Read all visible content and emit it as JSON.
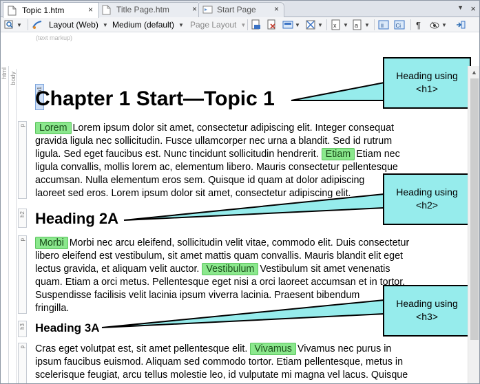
{
  "tabs": [
    {
      "label": "Topic 1.htm",
      "close": "×"
    },
    {
      "label": "Title Page.htm",
      "close": "×"
    },
    {
      "label": "Start Page",
      "close": "×"
    }
  ],
  "tabstrip_close": "×",
  "tabstrip_scroll": "▼",
  "toolbar": {
    "layout": "Layout (Web)",
    "medium": "Medium (default)",
    "page_layout": "Page Layout",
    "subtool_label": "(text markup)"
  },
  "structure": {
    "html": "html",
    "body": "body",
    "h1": "h1",
    "p": "p",
    "h2": "h2",
    "h3": "h3"
  },
  "doc": {
    "h1": "Chapter 1 Start—Topic 1",
    "h2": "Heading 2A",
    "h3": "Heading 3A",
    "para1": {
      "mark1": "Lorem",
      "line1": "Lorem ipsum dolor sit amet, consectetur adipiscing elit. Integer consequat",
      "line2": "gravida ligula nec sollicitudin. Fusce ullamcorper nec urna a blandit. Sed id rutrum",
      "line3a": "ligula. Sed eget faucibus est. Nunc tincidunt sollicitudin hendrerit.",
      "mark2": "Etiam",
      "line3b": "Etiam nec",
      "line4": "ligula convallis, mollis lorem ac, elementum libero. Mauris consectetur pellentesque",
      "line5": "accumsan. Nulla elementum eros sem. Quisque id quam at dolor adipiscing",
      "line6": "laoreet sed eros. Lorem ipsum dolor sit amet, consectetur adipiscing elit."
    },
    "para2": {
      "mark1": "Morbi",
      "line1": "Morbi nec arcu eleifend, sollicitudin velit vitae, commodo elit. Duis consectetur",
      "line2": "libero eleifend est vestibulum, sit amet mattis quam convallis. Mauris blandit elit eget",
      "line3a": "lectus gravida, et aliquam velit auctor.",
      "mark2": "Vestibulum",
      "line3b": "Vestibulum sit amet venenatis",
      "line4": "quam. Etiam a orci metus. Pellentesque eget nisi a orci laoreet accumsan et in tortor.",
      "line5": "Suspendisse facilisis velit lacinia ipsum viverra lacinia. Praesent bibendum",
      "line6": "fringilla."
    },
    "para3": {
      "line1a": "Cras eget volutpat est, sit amet pellentesque elit.",
      "mark1": "Vivamus",
      "line1b": "Vivamus nec purus in",
      "line2": "ipsum faucibus euismod. Aliquam sed commodo tortor. Etiam pellentesque, metus in",
      "line3": "scelerisque feugiat, arcu tellus molestie leo, id vulputate mi magna vel lacus. Quisque"
    }
  },
  "callouts": [
    {
      "line1": "Heading using",
      "line2": "<h1>"
    },
    {
      "line1": "Heading using",
      "line2": "<h2>"
    },
    {
      "line1": "Heading using",
      "line2": "<h3>"
    }
  ],
  "colors": {
    "callout_fill": "#96ecec",
    "mark_fill": "#8be88d",
    "tab_active": "#ffffff"
  }
}
